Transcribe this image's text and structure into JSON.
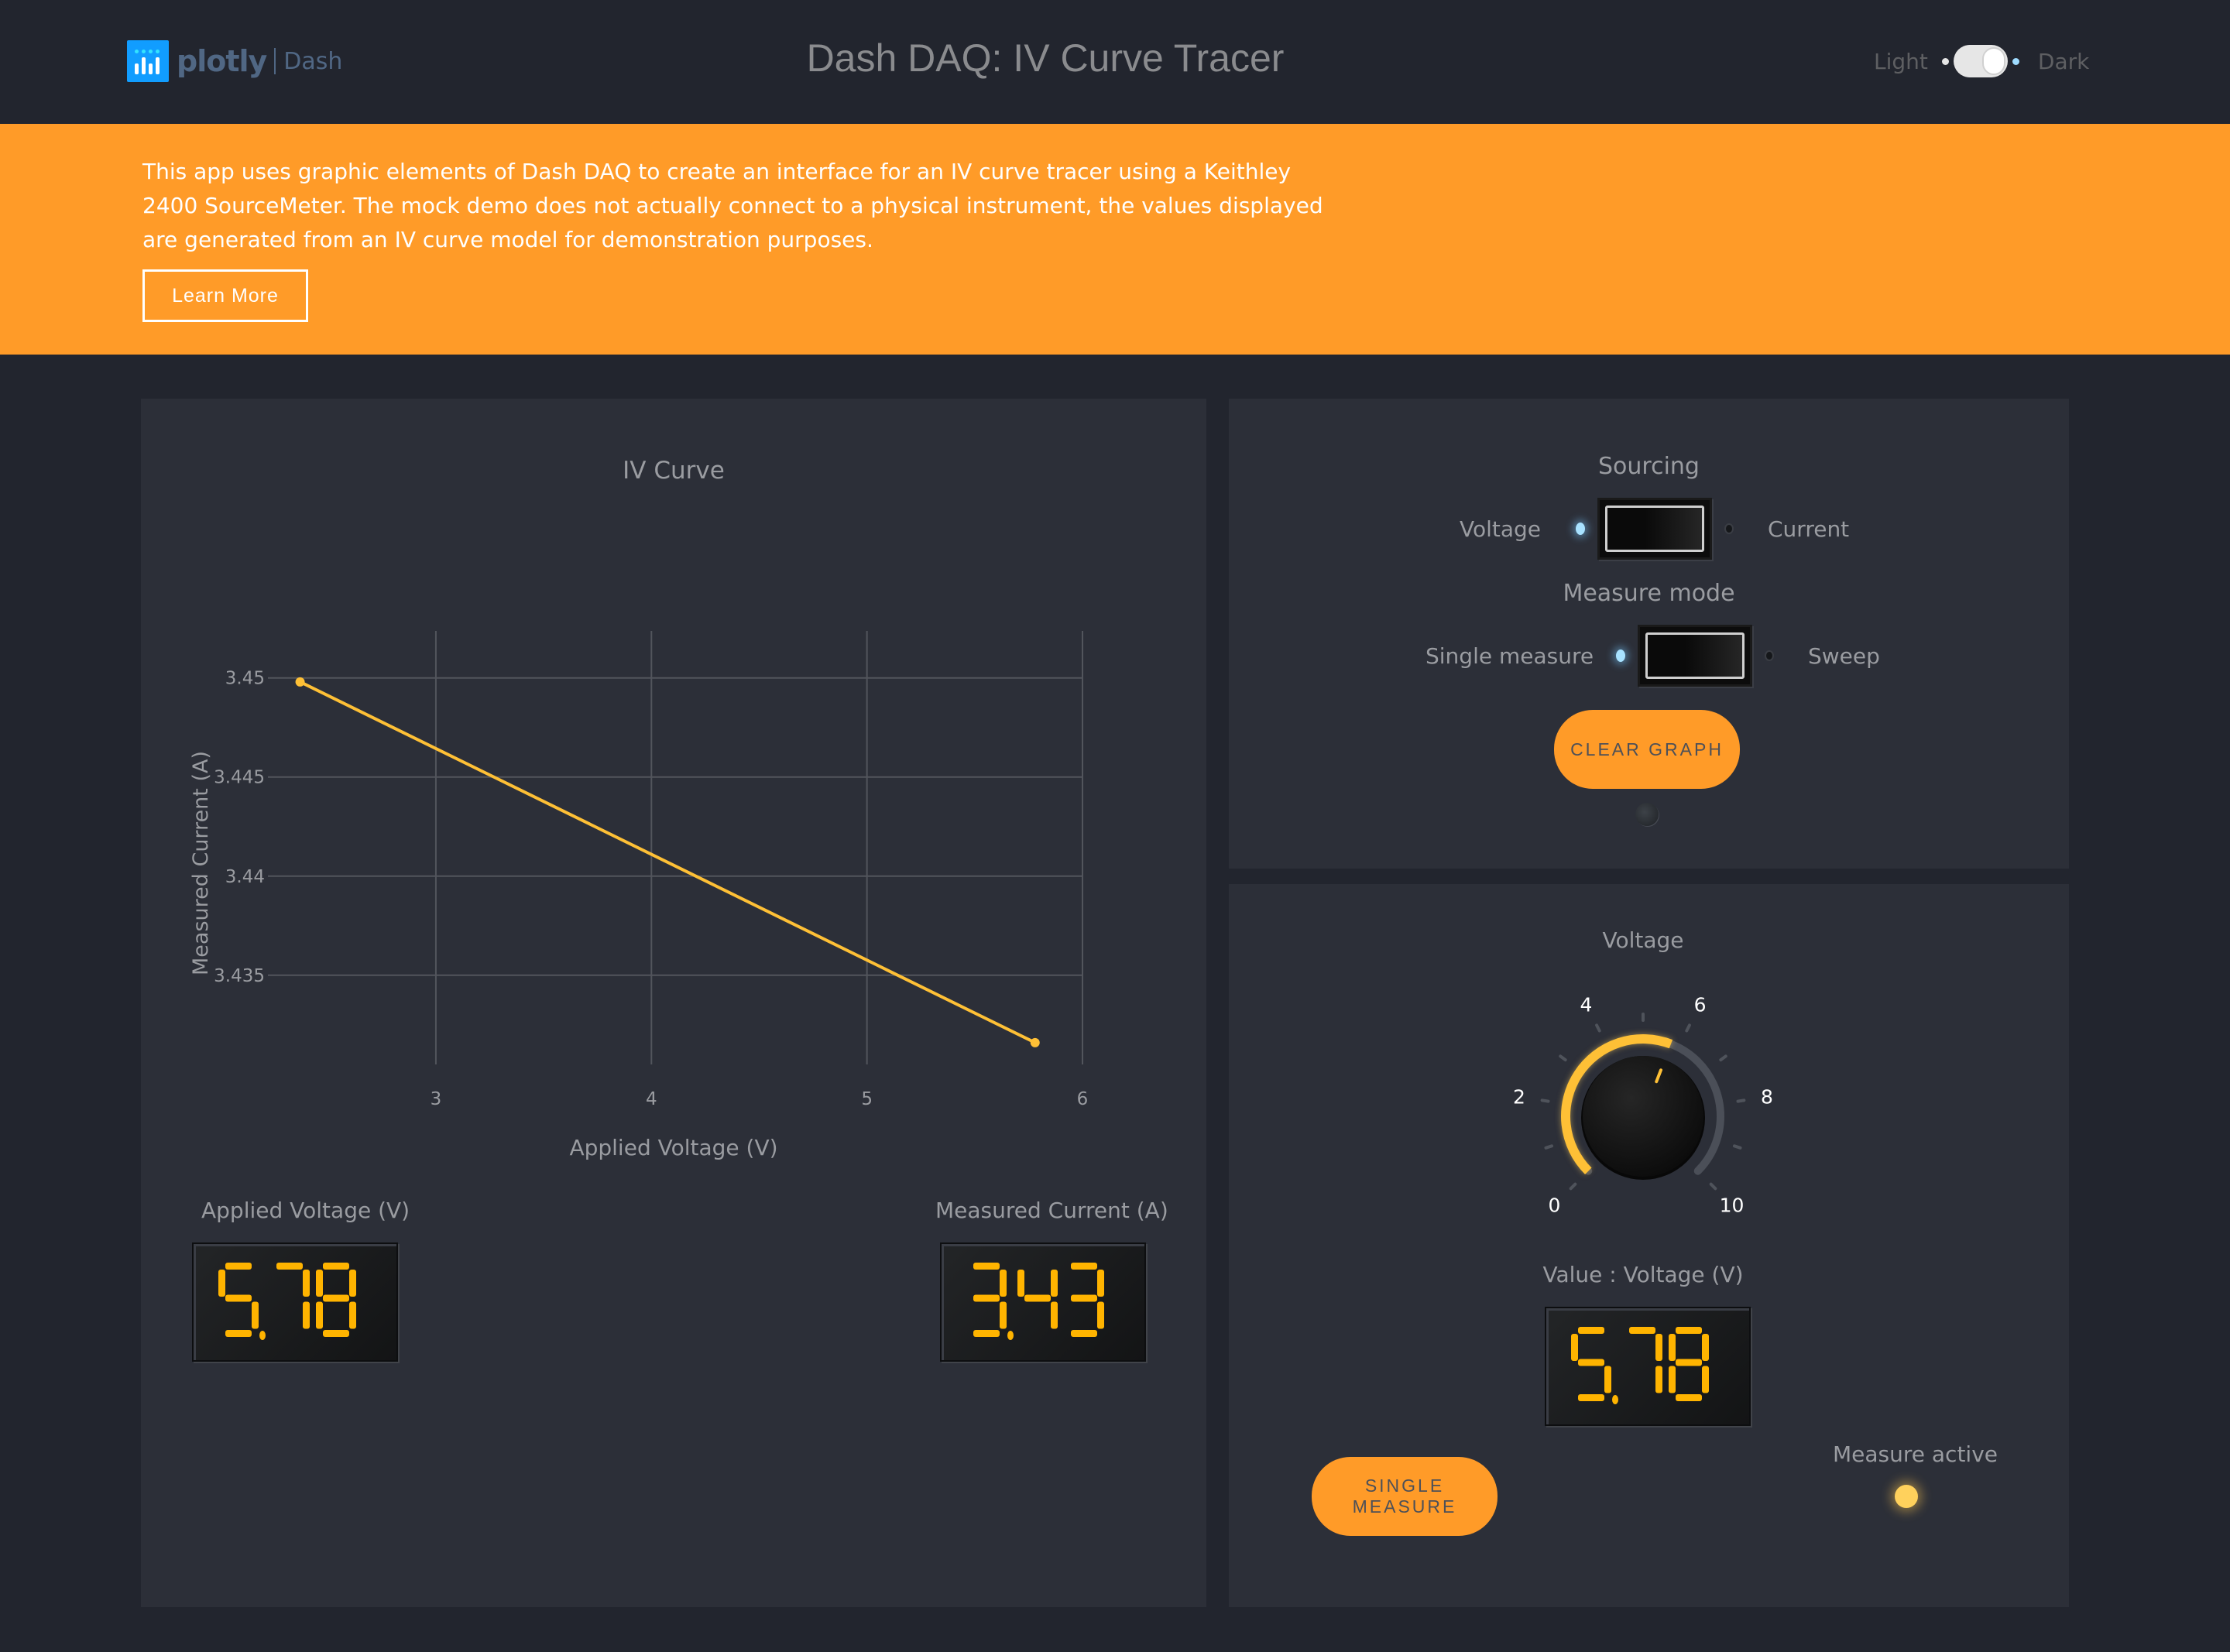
{
  "header": {
    "logo_text": "plotly",
    "logo_sub": "Dash",
    "title": "Dash DAQ: IV Curve Tracer",
    "theme_toggle": {
      "left_label": "Light",
      "right_label": "Dark",
      "value": "Dark"
    }
  },
  "banner": {
    "text": "This app uses graphic elements of Dash DAQ to create an interface for an IV curve tracer using a Keithley 2400 SourceMeter. The mock demo does not actually connect to a physical instrument, the values displayed are generated from an IV curve model for demonstration purposes.",
    "button_label": "Learn More",
    "color": "#ff9b28"
  },
  "chart_data": {
    "type": "line",
    "title": "IV Curve",
    "xlabel": "Applied Voltage (V)",
    "ylabel": "Measured Current (A)",
    "x_ticks": [
      "3",
      "4",
      "5",
      "6"
    ],
    "y_ticks": [
      "3.45",
      "3.445",
      "3.44",
      "3.435"
    ],
    "xlim": [
      2.35,
      6.0
    ],
    "ylim": [
      3.4305,
      3.4512
    ],
    "grid": true,
    "series": [
      {
        "name": "IV",
        "color": "#fec036",
        "x": [
          2.37,
          5.78
        ],
        "y": [
          3.4498,
          3.4316
        ]
      }
    ]
  },
  "displays": {
    "applied_voltage": {
      "label": "Applied Voltage (V)",
      "value": "5.78"
    },
    "measured_current": {
      "label": "Measured Current (A)",
      "value": "3.43"
    },
    "knob_value": {
      "label": "Value : Voltage (V)",
      "value": "5.78"
    }
  },
  "controls": {
    "sourcing": {
      "label": "Sourcing",
      "left": "Voltage",
      "right": "Current",
      "selected": "Voltage"
    },
    "measure_mode": {
      "label": "Measure mode",
      "left": "Single measure",
      "right": "Sweep",
      "selected": "Single measure"
    },
    "clear_graph_label": "CLEAR GRAPH",
    "clear_graph_indicator": "off"
  },
  "knob": {
    "label": "Voltage",
    "min": 0,
    "max": 10,
    "value": 5.78,
    "scale_labels": [
      "0",
      "2",
      "4",
      "6",
      "8",
      "10"
    ],
    "accent": "#fec036"
  },
  "measure": {
    "button_label": "SINGLE MEASURE",
    "active_label": "Measure active",
    "active": true
  }
}
